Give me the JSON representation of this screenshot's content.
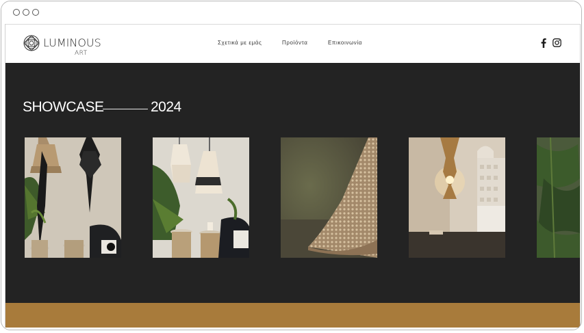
{
  "brand": {
    "name_main": "LUMINOUS",
    "name_sub": "ART"
  },
  "nav": {
    "items": [
      {
        "label": "Σχετικά με εμάς"
      },
      {
        "label": "Προϊόντα"
      },
      {
        "label": "Επικοινωνία"
      }
    ]
  },
  "social": {
    "facebook": "facebook-icon",
    "instagram": "instagram-icon"
  },
  "showcase": {
    "title": "SHOWCASE",
    "year": "2024"
  },
  "gallery": {
    "images": [
      {
        "alt": "macrame and fringe pendant lamps with plants"
      },
      {
        "alt": "cream crochet pendant lamps over side tables"
      },
      {
        "alt": "close-up of woven lamp shade"
      },
      {
        "alt": "wall sconce lamp in bedroom"
      },
      {
        "alt": "plants"
      }
    ]
  },
  "colors": {
    "accent": "#a87b3b",
    "background": "#232323"
  }
}
